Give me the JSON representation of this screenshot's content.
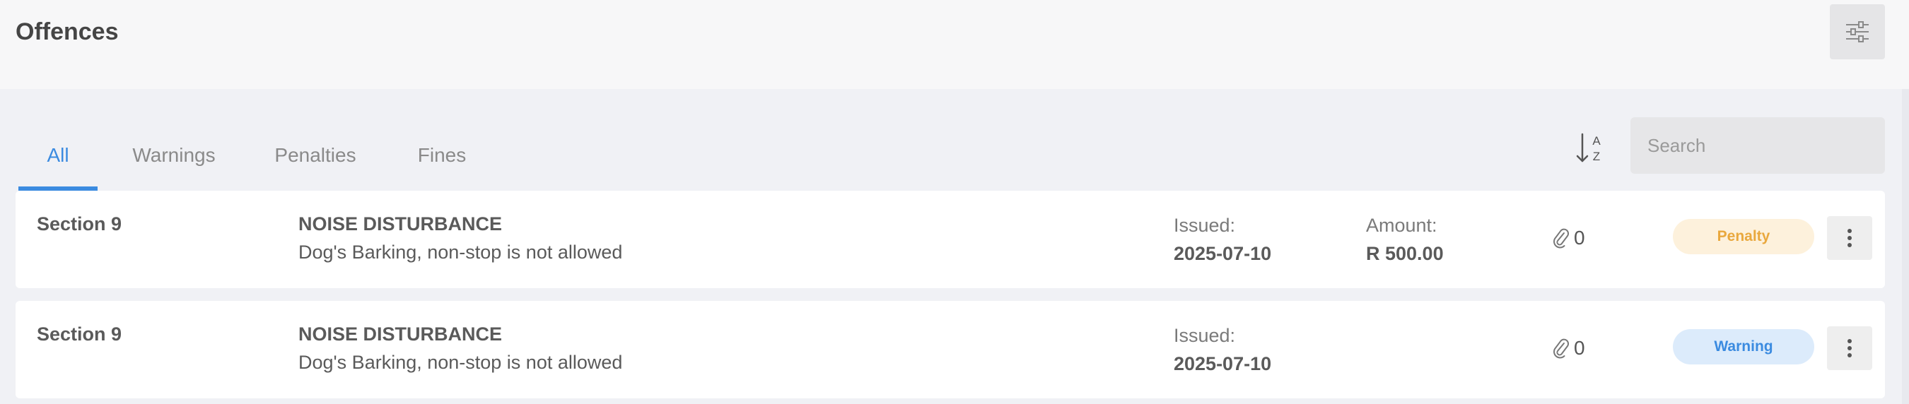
{
  "header": {
    "title": "Offences",
    "filter_icon": "sliders-icon"
  },
  "tabs": [
    {
      "label": "All",
      "active": true
    },
    {
      "label": "Warnings",
      "active": false
    },
    {
      "label": "Penalties",
      "active": false
    },
    {
      "label": "Fines",
      "active": false
    }
  ],
  "toolbar": {
    "sort_icon": "sort-alpha-icon",
    "sort_letters": {
      "top": "A",
      "bottom": "Z"
    },
    "search_placeholder": "Search"
  },
  "offences": [
    {
      "section": "Section 9",
      "title": "NOISE DISTURBANCE",
      "description": "Dog's Barking, non-stop is not allowed",
      "issued_label": "Issued:",
      "issued_date": "2025-07-10",
      "amount_label": "Amount:",
      "amount": "R 500.00",
      "attachments": "0",
      "status": "Penalty",
      "status_colors": {
        "bg": "#fdf1dc",
        "fg": "#e9a83d"
      }
    },
    {
      "section": "Section 9",
      "title": "NOISE DISTURBANCE",
      "description": "Dog's Barking, non-stop is not allowed",
      "issued_label": "Issued:",
      "issued_date": "2025-07-10",
      "amount_label": "",
      "amount": "",
      "attachments": "0",
      "status": "Warning",
      "status_colors": {
        "bg": "#dcebfb",
        "fg": "#3b8be0"
      }
    }
  ],
  "colors": {
    "accent": "#3b8be0",
    "background": "#f0f1f5",
    "header_bg": "#f7f7f8",
    "card_bg": "#ffffff"
  }
}
